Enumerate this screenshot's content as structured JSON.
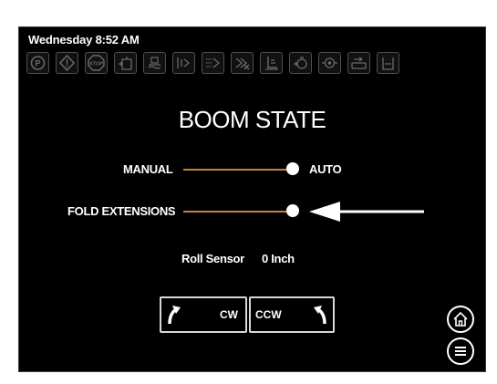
{
  "header": {
    "datetime": "Wednesday 8:52 AM",
    "status_icons": [
      {
        "name": "parking-brake-icon",
        "glyph": "P"
      },
      {
        "name": "warning-icon",
        "glyph": "!"
      },
      {
        "name": "stop-icon",
        "glyph": "STOP"
      },
      {
        "name": "tank-level-icon"
      },
      {
        "name": "rinse-tank-icon"
      },
      {
        "name": "boom-left-icon"
      },
      {
        "name": "boom-center-icon"
      },
      {
        "name": "boom-off-icon"
      },
      {
        "name": "boom-height-icon"
      },
      {
        "name": "engine-oil-icon"
      },
      {
        "name": "oil-pressure-icon"
      },
      {
        "name": "fuel-icon"
      },
      {
        "name": "container-icon"
      }
    ]
  },
  "page": {
    "title": "BOOM STATE"
  },
  "controls": {
    "mode_left_label": "MANUAL",
    "mode_right_label": "AUTO",
    "mode_value": "AUTO",
    "fold_label": "FOLD EXTENSIONS",
    "fold_value": "ON",
    "roll_sensor_label": "Roll Sensor",
    "roll_sensor_value": "0 Inch"
  },
  "buttons": {
    "cw_label": "CW",
    "ccw_label": "CCW"
  },
  "colors": {
    "background": "#000000",
    "slider_track": "#c8823c",
    "knob": "#ffffff",
    "icon_gray": "#6a6a6a"
  }
}
